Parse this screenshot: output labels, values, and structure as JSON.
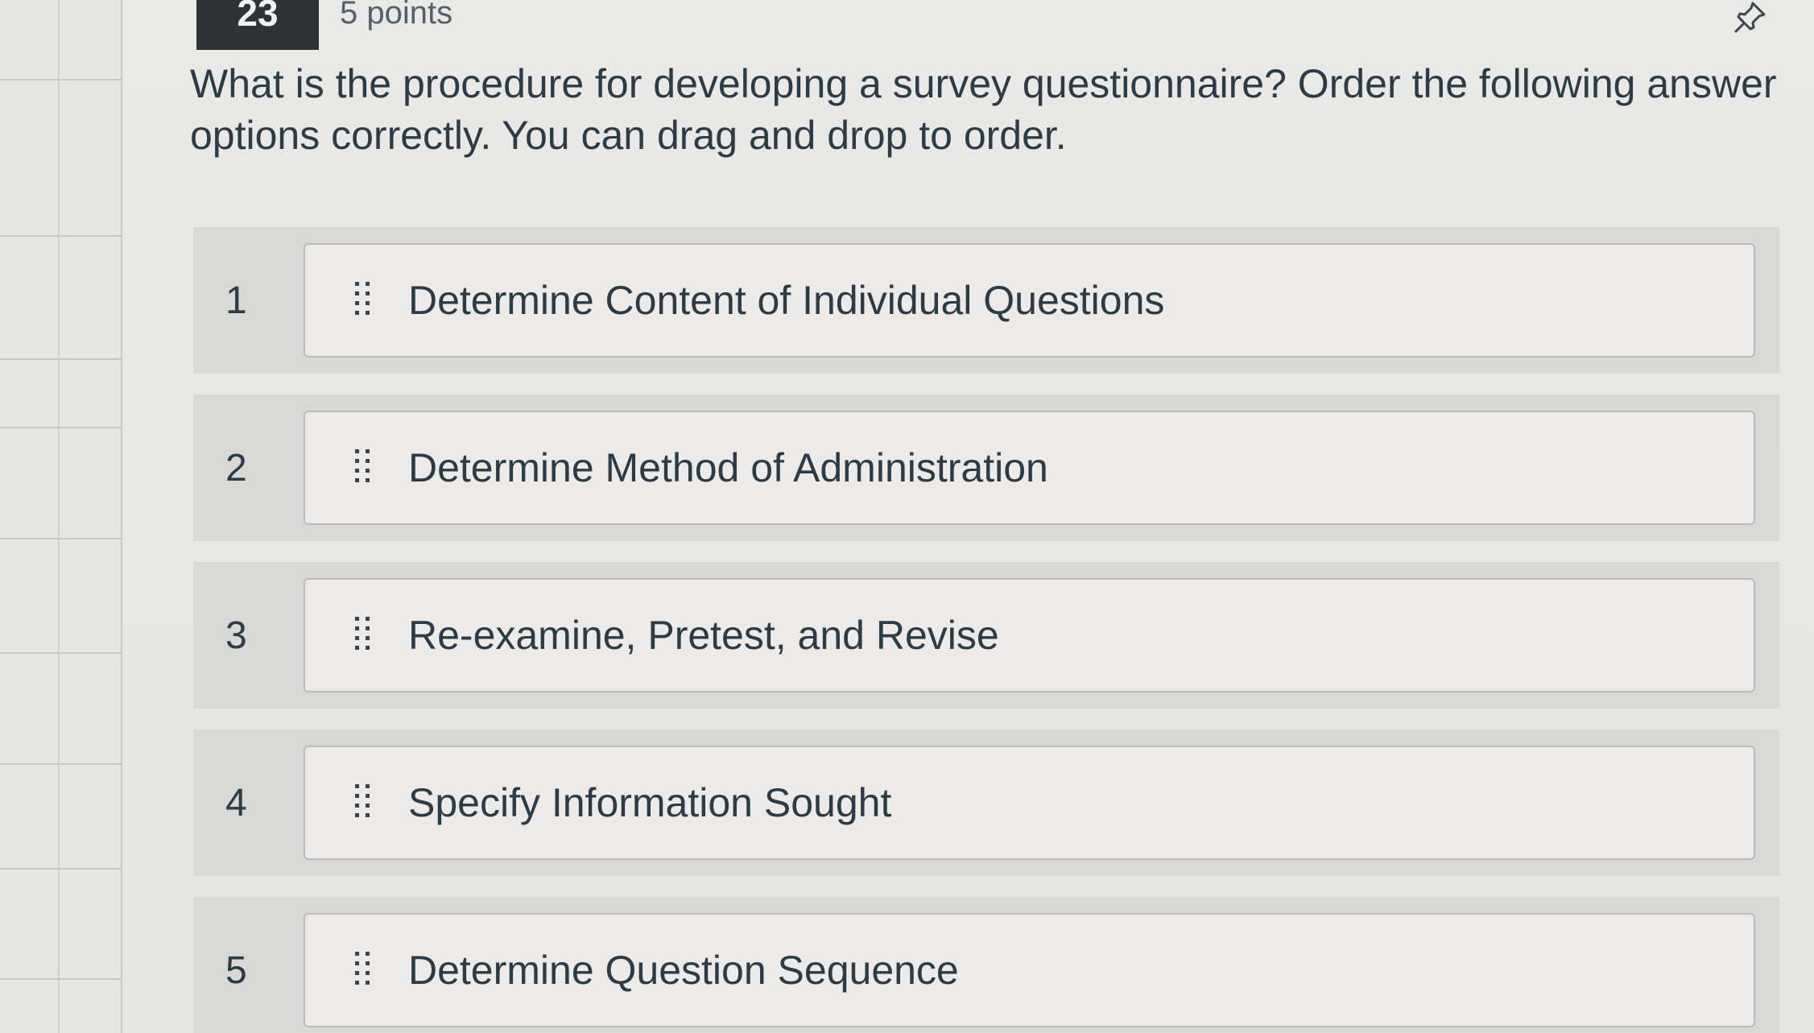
{
  "question": {
    "number": "23",
    "points": "5 points",
    "text": "What is the procedure for developing a survey questionnaire? Order the following answer options correctly. You can drag and drop to order."
  },
  "options": [
    {
      "position": "1",
      "label": "Determine Content of Individual Questions"
    },
    {
      "position": "2",
      "label": "Determine Method of Administration"
    },
    {
      "position": "3",
      "label": "Re-examine, Pretest, and Revise"
    },
    {
      "position": "4",
      "label": "Specify Information Sought"
    },
    {
      "position": "5",
      "label": "Determine Question Sequence"
    }
  ],
  "icons": {
    "drag_handle": "drag-handle-icon",
    "pin": "pin-icon"
  },
  "colors": {
    "question_number_bg": "#2f3337",
    "text": "#2d3b45"
  }
}
